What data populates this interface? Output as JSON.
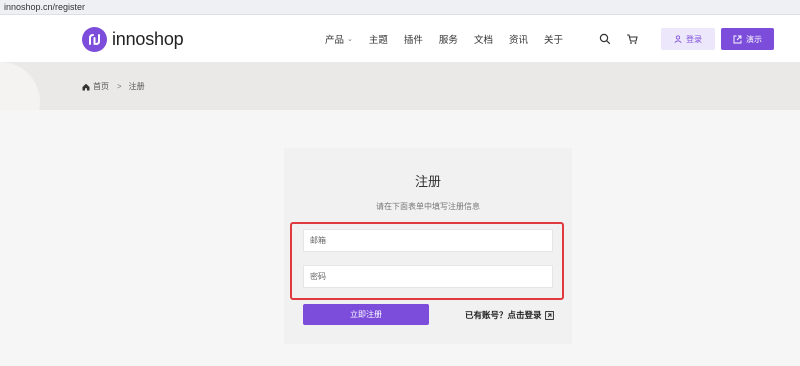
{
  "browser": {
    "url": "innoshop.cn/register"
  },
  "header": {
    "logo_text": "innoshop",
    "nav": [
      {
        "label": "产品",
        "has_dropdown": true
      },
      {
        "label": "主题"
      },
      {
        "label": "插件"
      },
      {
        "label": "服务"
      },
      {
        "label": "文档"
      },
      {
        "label": "资讯"
      },
      {
        "label": "关于"
      }
    ],
    "icons": [
      "search-icon",
      "cart-icon"
    ],
    "login_label": "登录",
    "demo_label": "演示"
  },
  "breadcrumb": {
    "home": "首页",
    "separator": ">",
    "current": "注册"
  },
  "form": {
    "title": "注册",
    "subtitle": "请在下面表单中填写注册信息",
    "email_placeholder": "邮箱",
    "password_placeholder": "密码",
    "submit_label": "立即注册",
    "login_link": "已有账号？点击登录"
  },
  "colors": {
    "brand": "#7c4ddb",
    "highlight": "#e0393e"
  }
}
